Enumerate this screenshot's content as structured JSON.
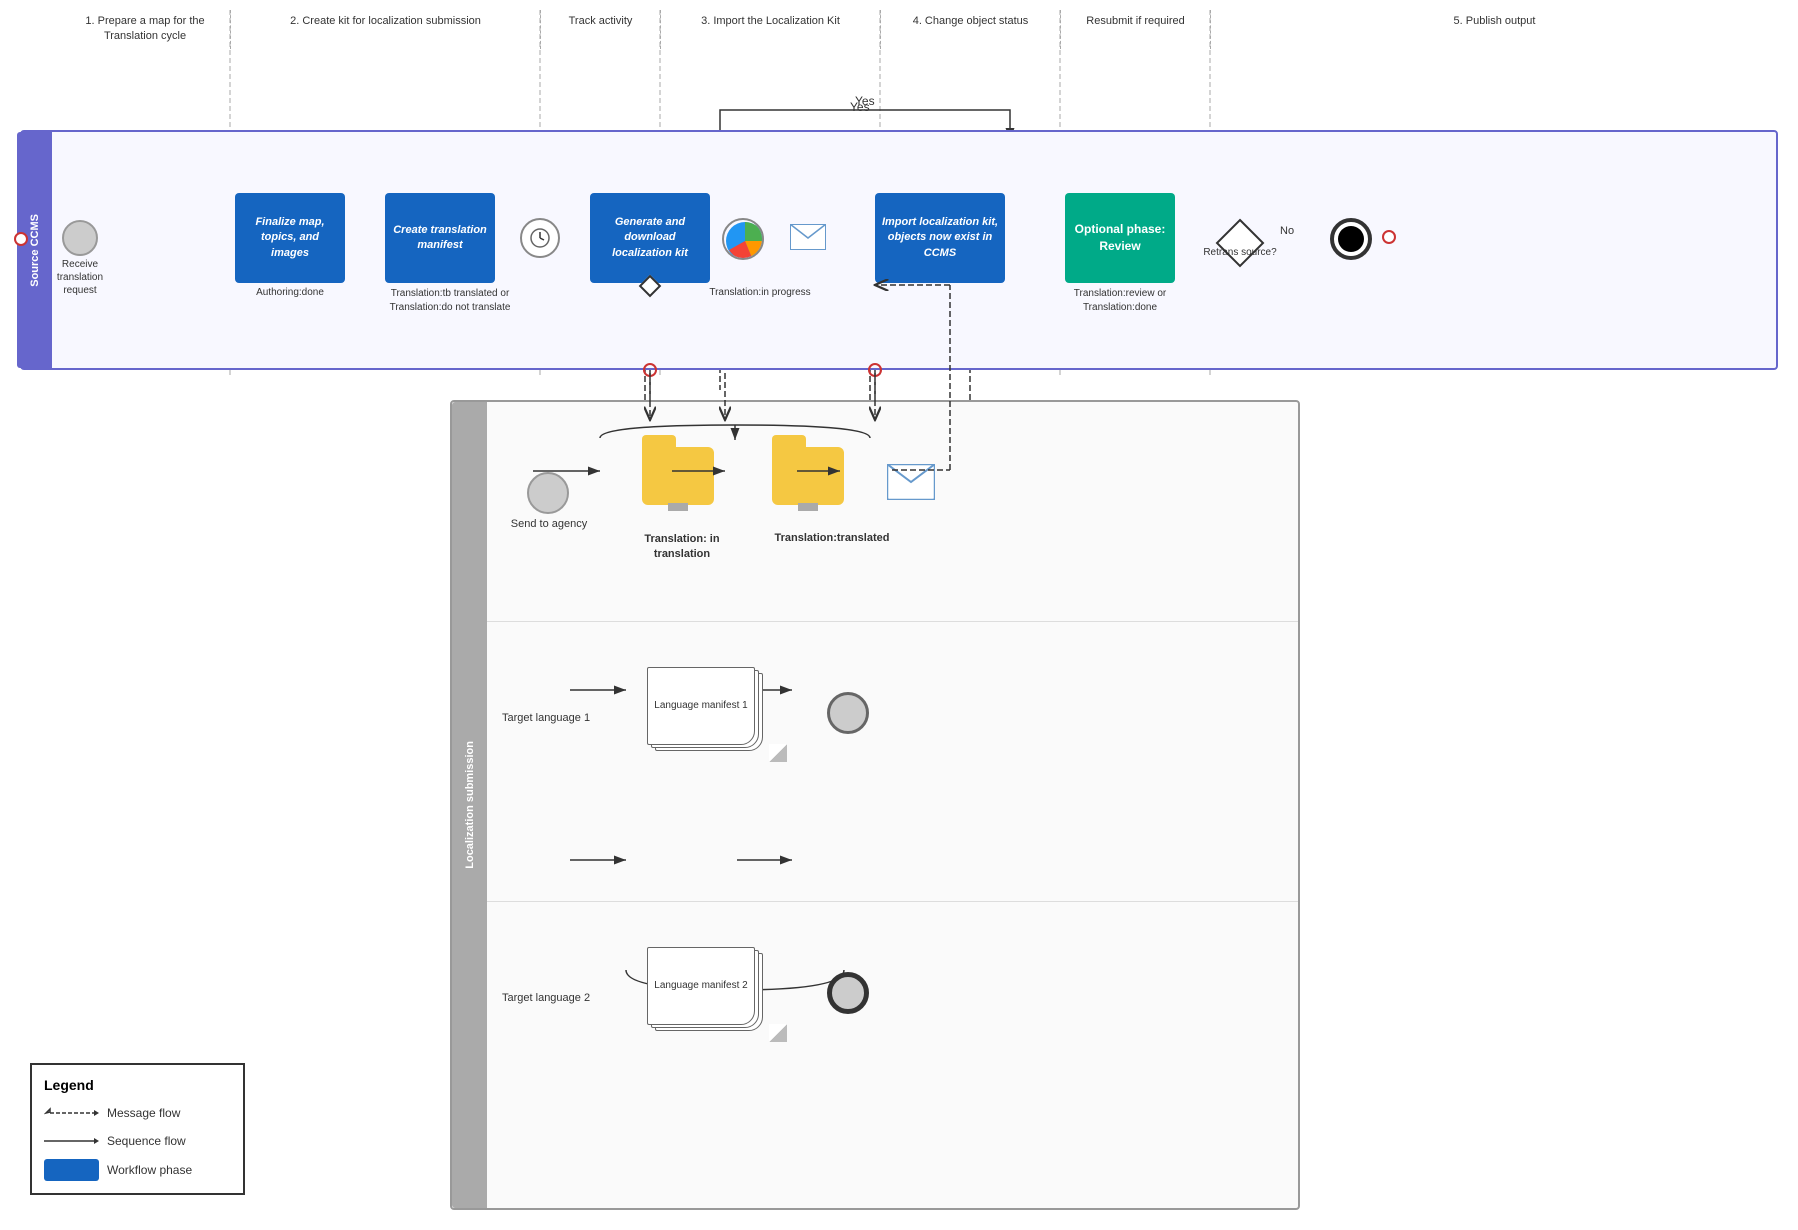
{
  "phases": [
    {
      "id": "phase1",
      "label": "1. Prepare a map for the Translation cycle"
    },
    {
      "id": "phase2",
      "label": "2. Create kit for localization submission"
    },
    {
      "id": "phase3",
      "label": "Track activity"
    },
    {
      "id": "phase4",
      "label": "3. Import the Localization Kit"
    },
    {
      "id": "phase5",
      "label": "4. Change object status"
    },
    {
      "id": "phase6",
      "label": "Resubmit if required"
    },
    {
      "id": "phase7",
      "label": "5. Publish output"
    }
  ],
  "swimlane": {
    "label": "Source CCMS"
  },
  "nodes": {
    "start_circle": "Start",
    "receive_request": "Receive translation request",
    "finalize_map": "Finalize map, topics, and images",
    "authoring_done": "Authoring:done",
    "create_manifest": "Create translation manifest",
    "tb_translated": "Translation:tb translated\nor\nTranslation:do not translate",
    "generate_kit": "Generate and download localization kit",
    "in_progress": "Translation:in progress",
    "import_kit": "Import localization kit, objects now exist in CCMS",
    "optional_review": "Optional phase: Review",
    "review_done": "Translation:review\nor\nTranslation:done",
    "retrans_source": "Retrans source?",
    "end_node": "End",
    "yes_label": "Yes",
    "no_label": "No"
  },
  "localization": {
    "label": "Localization submission",
    "send_to_agency": "Send to agency",
    "in_translation": "Translation:\nin translation",
    "translated": "Translation:translated",
    "target_lang1": "Target language 1",
    "target_lang2": "Target language 2",
    "lang_manifest1": "Language manifest 1",
    "lang_manifest2": "Language manifest 2"
  },
  "legend": {
    "title": "Legend",
    "message_flow": "Message flow",
    "sequence_flow": "Sequence flow",
    "workflow_phase": "Workflow phase"
  }
}
